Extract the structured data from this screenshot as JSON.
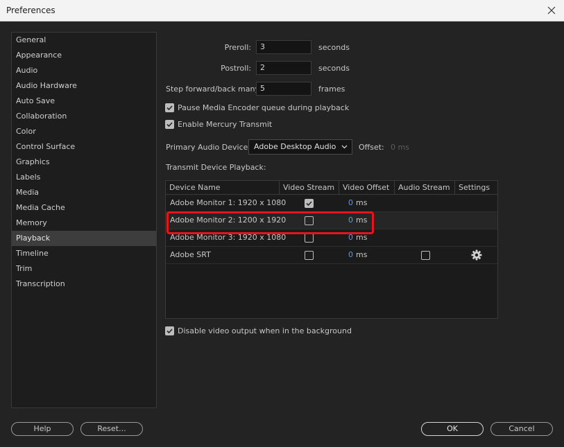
{
  "window": {
    "title": "Preferences"
  },
  "sidebar": {
    "items": [
      {
        "label": "General"
      },
      {
        "label": "Appearance"
      },
      {
        "label": "Audio"
      },
      {
        "label": "Audio Hardware"
      },
      {
        "label": "Auto Save"
      },
      {
        "label": "Collaboration"
      },
      {
        "label": "Color"
      },
      {
        "label": "Control Surface"
      },
      {
        "label": "Graphics"
      },
      {
        "label": "Labels"
      },
      {
        "label": "Media"
      },
      {
        "label": "Media Cache"
      },
      {
        "label": "Memory"
      },
      {
        "label": "Playback"
      },
      {
        "label": "Timeline"
      },
      {
        "label": "Trim"
      },
      {
        "label": "Transcription"
      }
    ],
    "selected": "Playback"
  },
  "playback": {
    "preroll_label": "Preroll:",
    "preroll_value": "3",
    "preroll_unit": "seconds",
    "postroll_label": "Postroll:",
    "postroll_value": "2",
    "postroll_unit": "seconds",
    "step_label": "Step forward/back many:",
    "step_value": "5",
    "step_unit": "frames",
    "pause_encoder_label": "Pause Media Encoder queue during playback",
    "pause_encoder_checked": true,
    "mercury_label": "Enable Mercury Transmit",
    "mercury_checked": true,
    "audio_device_label": "Primary Audio Device:",
    "audio_device_value": "Adobe Desktop Audio",
    "offset_label": "Offset:",
    "offset_value": "0 ms",
    "transmit_label": "Transmit Device Playback:",
    "disable_bg_label": "Disable video output when in the background",
    "disable_bg_checked": true
  },
  "device_table": {
    "headers": [
      "Device Name",
      "Video Stream",
      "Video Offset",
      "Audio Stream",
      "Settings"
    ],
    "rows": [
      {
        "name": "Adobe Monitor 1: 1920 x 1080",
        "video_stream": true,
        "offset": "0",
        "unit": "ms"
      },
      {
        "name": "Adobe Monitor 2: 1200 x 1920",
        "video_stream": false,
        "offset": "0",
        "unit": "ms"
      },
      {
        "name": "Adobe Monitor 3: 1920 x 1080",
        "video_stream": false,
        "offset": "0",
        "unit": "ms"
      },
      {
        "name": "Adobe SRT",
        "video_stream": false,
        "offset": "0",
        "unit": "ms",
        "audio_stream": false,
        "settings_icon": "gear-icon"
      }
    ]
  },
  "buttons": {
    "help": "Help",
    "reset": "Reset...",
    "ok": "OK",
    "cancel": "Cancel"
  },
  "colors": {
    "highlight": "#e8131b",
    "offset_blue": "#4a9fff",
    "selected_item": "#3d3d3d"
  }
}
